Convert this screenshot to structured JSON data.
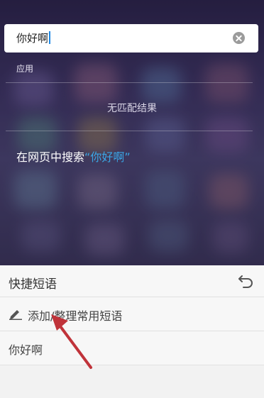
{
  "search": {
    "query": "你好啊"
  },
  "results": {
    "section_label": "应用",
    "no_results": "无匹配结果",
    "web_search_prefix": "在网页中搜索",
    "web_search_open_quote": "“",
    "web_search_query": "你好啊",
    "web_search_close_quote": "”"
  },
  "quick_phrases": {
    "title": "快捷短语",
    "add_label": "添加/整理常用短语",
    "items": [
      "你好啊"
    ]
  },
  "colors": {
    "accent": "#3aa6e6",
    "annotation_arrow": "#c0333a"
  },
  "icons": [
    "clear-icon",
    "back-icon",
    "edit-icon"
  ]
}
